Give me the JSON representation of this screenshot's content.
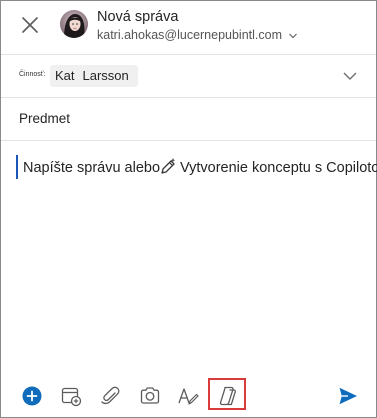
{
  "header": {
    "title": "Nová správa",
    "account": "katri.ahokas@lucernepubintl.com",
    "close_icon": "close-icon",
    "avatar_icon": "avatar"
  },
  "to": {
    "label": "Činnosť:",
    "recipient_first": "Kat",
    "recipient_last": "Larsson",
    "expand_icon": "chevron-down-icon"
  },
  "subject": {
    "placeholder": "Predmet"
  },
  "body": {
    "placeholder": "Napíšte správu alebo",
    "copilot_prompt": "Vytvorenie konceptu s Copilotom",
    "copilot_icon": "pen-sparkle-icon"
  },
  "toolbar": {
    "items": [
      "add-icon",
      "calendar-add-icon",
      "attach-icon",
      "camera-icon",
      "pen-icon",
      "copilot-icon",
      "send-icon"
    ],
    "highlighted": "copilot-icon"
  },
  "colors": {
    "accent": "#0f6cbd",
    "highlight": "#d93b3b"
  }
}
